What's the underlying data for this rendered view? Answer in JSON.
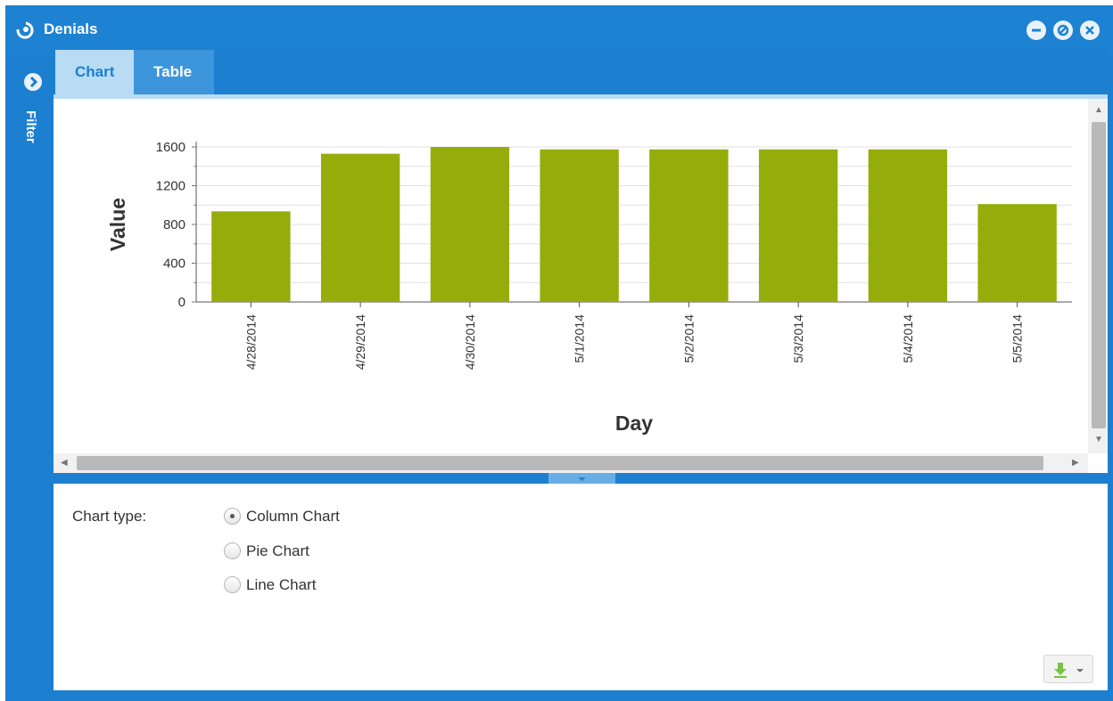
{
  "window": {
    "title": "Denials",
    "title_icon": "app-swirl-icon",
    "controls": [
      "minimize-icon",
      "restore-icon",
      "close-icon"
    ]
  },
  "sidebar": {
    "label": "Filter",
    "expand_icon": "chevron-right-icon"
  },
  "tabs": [
    {
      "label": "Chart",
      "active": true
    },
    {
      "label": "Table",
      "active": false
    }
  ],
  "chart_data": {
    "type": "bar",
    "categories": [
      "4/28/2014",
      "4/29/2014",
      "4/30/2014",
      "5/1/2014",
      "5/2/2014",
      "5/3/2014",
      "5/4/2014",
      "5/5/2014"
    ],
    "values": [
      935,
      1530,
      1600,
      1575,
      1575,
      1575,
      1575,
      1010
    ],
    "xlabel": "Day",
    "ylabel": "Value",
    "ylim": [
      0,
      1600
    ],
    "yticks": [
      0,
      400,
      800,
      1200,
      1600
    ],
    "ytick_labels": [
      "0",
      "400",
      "800",
      "1200",
      "1600"
    ],
    "bar_color": "#94ad0a",
    "grid": true
  },
  "options": {
    "label": "Chart type:",
    "choices": [
      {
        "label": "Column Chart",
        "selected": true
      },
      {
        "label": "Pie Chart",
        "selected": false
      },
      {
        "label": "Line Chart",
        "selected": false
      }
    ]
  },
  "export": {
    "icon": "download-icon",
    "dropdown_icon": "caret-down-icon"
  },
  "colors": {
    "accent": "#1c7fd0",
    "tab_active_bg": "#b8dcf3",
    "tab_inactive_bg": "#3d95dc"
  }
}
